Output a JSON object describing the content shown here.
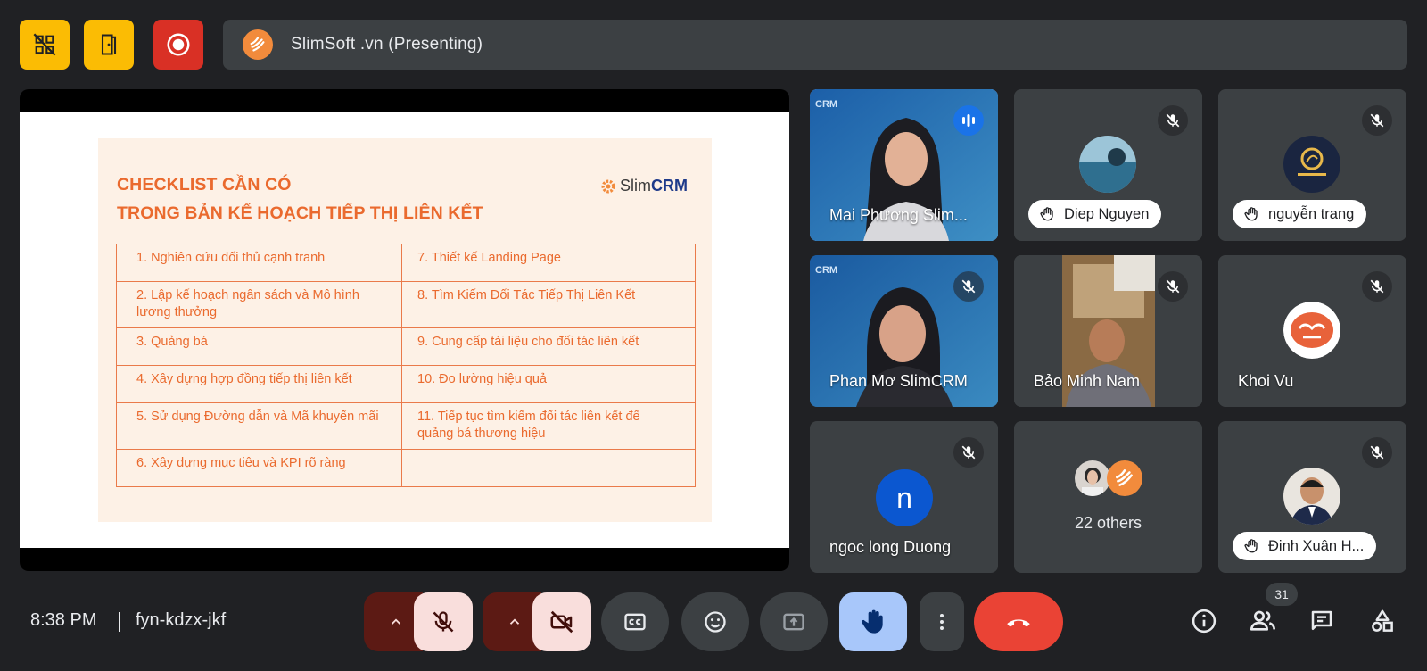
{
  "top_bar": {
    "presenting_title": "SlimSoft .vn (Presenting)"
  },
  "slide": {
    "title_line1": "CHECKLIST CẦN CÓ",
    "title_line2": "TRONG BẢN KẾ HOẠCH TIẾP THỊ LIÊN KẾT",
    "logo_prefix": "Slim",
    "logo_suffix": "CRM",
    "rows": [
      [
        "1. Nghiên cứu đối thủ cạnh tranh",
        "7. Thiết kế Landing Page"
      ],
      [
        "2. Lập kế hoạch ngân sách và Mô hình lương thưởng",
        "8. Tìm Kiếm Đối Tác Tiếp Thị Liên Kết"
      ],
      [
        "3. Quảng bá",
        "9. Cung cấp tài liệu cho đối tác liên kết"
      ],
      [
        "4. Xây dựng hợp đồng tiếp thị liên kết",
        "10. Đo lường hiệu quả"
      ],
      [
        "5. Sử dụng Đường dẫn và Mã khuyến mãi",
        "11. Tiếp tục tìm kiếm đối tác liên kết để quảng bá thương hiệu"
      ],
      [
        "6. Xây dựng mục tiêu và KPI rõ ràng",
        ""
      ]
    ]
  },
  "participants": {
    "p1": "Mai Phương Slim...",
    "p2": "Diep Nguyen",
    "p3": "nguyễn trang",
    "p4": "Phan Mơ SlimCRM",
    "p5": "Bảo Minh Nam",
    "p6": "Khoi Vu",
    "p7": "ngoc long Duong",
    "p7_initial": "n",
    "p8": "22 others",
    "p9": "Đinh Xuân H..."
  },
  "bottom_bar": {
    "time": "8:38 PM",
    "meeting_code": "fyn-kdzx-jkf",
    "people_count": "31"
  },
  "colors": {
    "background": "#202124",
    "tile": "#3c4043",
    "accent_blue": "#8ab4f8",
    "end_call": "#ea4335",
    "slide_orange": "#ea6a2e"
  }
}
